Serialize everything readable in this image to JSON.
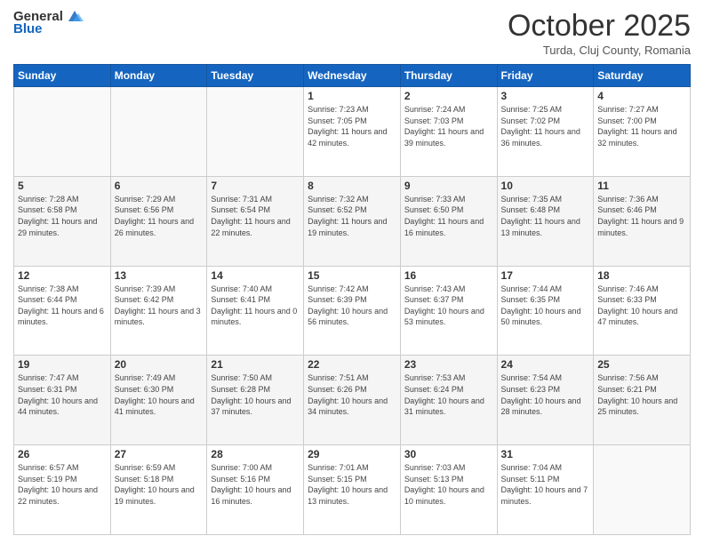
{
  "header": {
    "logo": {
      "general": "General",
      "blue": "Blue"
    },
    "title": "October 2025",
    "location": "Turda, Cluj County, Romania"
  },
  "weekdays": [
    "Sunday",
    "Monday",
    "Tuesday",
    "Wednesday",
    "Thursday",
    "Friday",
    "Saturday"
  ],
  "weeks": [
    [
      {
        "day": "",
        "info": ""
      },
      {
        "day": "",
        "info": ""
      },
      {
        "day": "",
        "info": ""
      },
      {
        "day": "1",
        "info": "Sunrise: 7:23 AM\nSunset: 7:05 PM\nDaylight: 11 hours and 42 minutes."
      },
      {
        "day": "2",
        "info": "Sunrise: 7:24 AM\nSunset: 7:03 PM\nDaylight: 11 hours and 39 minutes."
      },
      {
        "day": "3",
        "info": "Sunrise: 7:25 AM\nSunset: 7:02 PM\nDaylight: 11 hours and 36 minutes."
      },
      {
        "day": "4",
        "info": "Sunrise: 7:27 AM\nSunset: 7:00 PM\nDaylight: 11 hours and 32 minutes."
      }
    ],
    [
      {
        "day": "5",
        "info": "Sunrise: 7:28 AM\nSunset: 6:58 PM\nDaylight: 11 hours and 29 minutes."
      },
      {
        "day": "6",
        "info": "Sunrise: 7:29 AM\nSunset: 6:56 PM\nDaylight: 11 hours and 26 minutes."
      },
      {
        "day": "7",
        "info": "Sunrise: 7:31 AM\nSunset: 6:54 PM\nDaylight: 11 hours and 22 minutes."
      },
      {
        "day": "8",
        "info": "Sunrise: 7:32 AM\nSunset: 6:52 PM\nDaylight: 11 hours and 19 minutes."
      },
      {
        "day": "9",
        "info": "Sunrise: 7:33 AM\nSunset: 6:50 PM\nDaylight: 11 hours and 16 minutes."
      },
      {
        "day": "10",
        "info": "Sunrise: 7:35 AM\nSunset: 6:48 PM\nDaylight: 11 hours and 13 minutes."
      },
      {
        "day": "11",
        "info": "Sunrise: 7:36 AM\nSunset: 6:46 PM\nDaylight: 11 hours and 9 minutes."
      }
    ],
    [
      {
        "day": "12",
        "info": "Sunrise: 7:38 AM\nSunset: 6:44 PM\nDaylight: 11 hours and 6 minutes."
      },
      {
        "day": "13",
        "info": "Sunrise: 7:39 AM\nSunset: 6:42 PM\nDaylight: 11 hours and 3 minutes."
      },
      {
        "day": "14",
        "info": "Sunrise: 7:40 AM\nSunset: 6:41 PM\nDaylight: 11 hours and 0 minutes."
      },
      {
        "day": "15",
        "info": "Sunrise: 7:42 AM\nSunset: 6:39 PM\nDaylight: 10 hours and 56 minutes."
      },
      {
        "day": "16",
        "info": "Sunrise: 7:43 AM\nSunset: 6:37 PM\nDaylight: 10 hours and 53 minutes."
      },
      {
        "day": "17",
        "info": "Sunrise: 7:44 AM\nSunset: 6:35 PM\nDaylight: 10 hours and 50 minutes."
      },
      {
        "day": "18",
        "info": "Sunrise: 7:46 AM\nSunset: 6:33 PM\nDaylight: 10 hours and 47 minutes."
      }
    ],
    [
      {
        "day": "19",
        "info": "Sunrise: 7:47 AM\nSunset: 6:31 PM\nDaylight: 10 hours and 44 minutes."
      },
      {
        "day": "20",
        "info": "Sunrise: 7:49 AM\nSunset: 6:30 PM\nDaylight: 10 hours and 41 minutes."
      },
      {
        "day": "21",
        "info": "Sunrise: 7:50 AM\nSunset: 6:28 PM\nDaylight: 10 hours and 37 minutes."
      },
      {
        "day": "22",
        "info": "Sunrise: 7:51 AM\nSunset: 6:26 PM\nDaylight: 10 hours and 34 minutes."
      },
      {
        "day": "23",
        "info": "Sunrise: 7:53 AM\nSunset: 6:24 PM\nDaylight: 10 hours and 31 minutes."
      },
      {
        "day": "24",
        "info": "Sunrise: 7:54 AM\nSunset: 6:23 PM\nDaylight: 10 hours and 28 minutes."
      },
      {
        "day": "25",
        "info": "Sunrise: 7:56 AM\nSunset: 6:21 PM\nDaylight: 10 hours and 25 minutes."
      }
    ],
    [
      {
        "day": "26",
        "info": "Sunrise: 6:57 AM\nSunset: 5:19 PM\nDaylight: 10 hours and 22 minutes."
      },
      {
        "day": "27",
        "info": "Sunrise: 6:59 AM\nSunset: 5:18 PM\nDaylight: 10 hours and 19 minutes."
      },
      {
        "day": "28",
        "info": "Sunrise: 7:00 AM\nSunset: 5:16 PM\nDaylight: 10 hours and 16 minutes."
      },
      {
        "day": "29",
        "info": "Sunrise: 7:01 AM\nSunset: 5:15 PM\nDaylight: 10 hours and 13 minutes."
      },
      {
        "day": "30",
        "info": "Sunrise: 7:03 AM\nSunset: 5:13 PM\nDaylight: 10 hours and 10 minutes."
      },
      {
        "day": "31",
        "info": "Sunrise: 7:04 AM\nSunset: 5:11 PM\nDaylight: 10 hours and 7 minutes."
      },
      {
        "day": "",
        "info": ""
      }
    ]
  ]
}
